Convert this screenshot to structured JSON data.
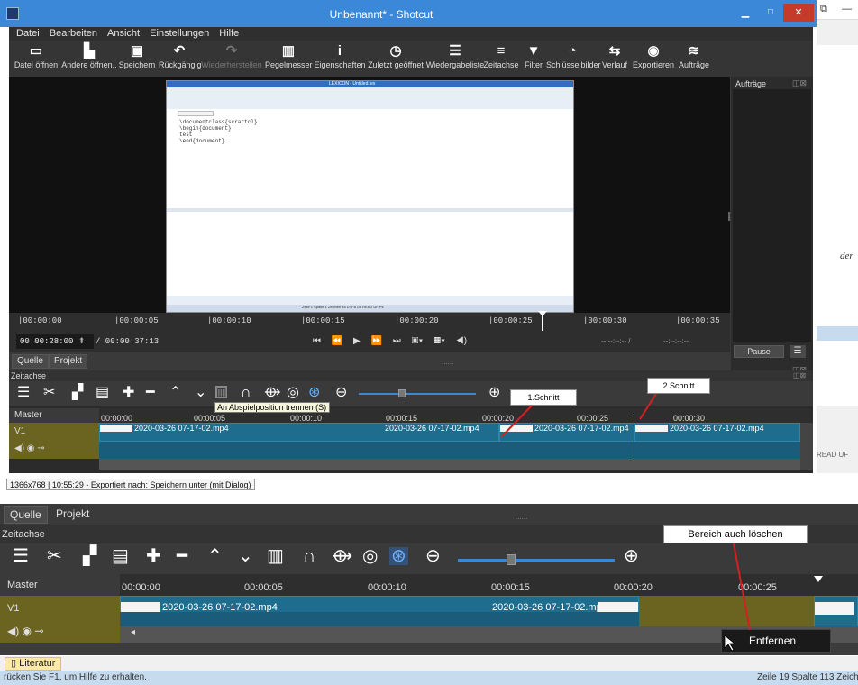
{
  "window": {
    "title": "Unbenannt* - Shotcut"
  },
  "menu": [
    "Datei",
    "Bearbeiten",
    "Ansicht",
    "Einstellungen",
    "Hilfe"
  ],
  "toolbar": [
    {
      "label": "Datei öffnen",
      "icon": "folder-open-icon",
      "glyph": "▭"
    },
    {
      "label": "Andere öffnen..",
      "icon": "open-other-icon",
      "glyph": "▙"
    },
    {
      "label": "Speichern",
      "icon": "save-icon",
      "glyph": "▣"
    },
    {
      "label": "Rückgängig",
      "icon": "undo-icon",
      "glyph": "↶"
    },
    {
      "label": "Wiederherstellen",
      "icon": "redo-icon",
      "glyph": "↷",
      "disabled": true
    },
    {
      "label": "Pegelmesser",
      "icon": "level-meter-icon",
      "glyph": "▥"
    },
    {
      "label": "Eigenschaften",
      "icon": "info-icon",
      "glyph": "i"
    },
    {
      "label": "Zuletzt geöffnet",
      "icon": "clock-icon",
      "glyph": "◷"
    },
    {
      "label": "Wiedergabeliste",
      "icon": "playlist-icon",
      "glyph": "☰"
    },
    {
      "label": "Zeitachse",
      "icon": "timeline-icon",
      "glyph": "≡"
    },
    {
      "label": "Filter",
      "icon": "filter-icon",
      "glyph": "▼"
    },
    {
      "label": "Schlüsselbilder",
      "icon": "stopwatch-icon",
      "glyph": "◔"
    },
    {
      "label": "Verlauf",
      "icon": "history-icon",
      "glyph": "⇆"
    },
    {
      "label": "Exportieren",
      "icon": "export-icon",
      "glyph": "◉"
    },
    {
      "label": "Aufträge",
      "icon": "jobs-icon",
      "glyph": "≋"
    }
  ],
  "screen_content": {
    "title": "LEXICON - Untitled.tex",
    "lines": [
      "\\documentclass{scrartcl}",
      "\\begin{document}",
      "test",
      "\\end{document}"
    ],
    "statusline": "Zeile 1 Spalte 1 Zeichen 48     UTF8     Ok    READ UF   Ps"
  },
  "jobs_panel": {
    "title": "Aufträge",
    "pause": "Pause",
    "menu": "☰"
  },
  "ruler_labels": [
    "|00:00:00",
    "|00:00:05",
    "|00:00:10",
    "|00:00:15",
    "|00:00:20",
    "|00:00:25",
    "|00:00:30",
    "|00:00:35"
  ],
  "transport": {
    "current": "00:00:28:00",
    "total": "/ 00:00:37:13",
    "inout_a": "--:--:--:-- /",
    "inout_b": "--:--:--:--"
  },
  "source_tabs": [
    "Quelle",
    "Projekt"
  ],
  "timeline": {
    "label": "Zeitachse",
    "master": "Master",
    "track": "V1",
    "tooltip": "An Abspielposition trennen (S)",
    "tick_labels": [
      "00:00:00",
      "00:00:05",
      "00:00:10",
      "00:00:15",
      "00:00:20",
      "00:00:25",
      "00:00:30"
    ],
    "clip_name": "2020-03-26 07-17-02.mp4",
    "callout_1": "1.Schnitt",
    "callout_2": "2.Schnitt"
  },
  "status_text": "1366x768 | 10:55:29 - Exportiert nach: Speichern unter (mit Dialog)",
  "bottom": {
    "tabs": [
      "Quelle",
      "Projekt"
    ],
    "label": "Zeitachse",
    "master": "Master",
    "track": "V1",
    "tick_labels": [
      "00:00:00",
      "00:00:05",
      "00:00:10",
      "00:00:15",
      "00:00:20",
      "00:00:25"
    ],
    "clip_name": "2020-03-26 07-17-02.mp4",
    "callout": "Bereich auch löschen",
    "context_item": "Entfernen"
  },
  "word": {
    "tab": "Literatur",
    "hint": "rücken Sie F1, um Hilfe zu erhalten.",
    "pos": "Zeile 19 Spalte 113 Zeich",
    "side_italic": "der",
    "side_read": "READ UF"
  },
  "colors": {
    "titlebar": "#3c88d8",
    "clip": "#1f6d8e",
    "track_header": "#6b6320",
    "playhead": "#ffffff",
    "arrow": "#d42020"
  }
}
